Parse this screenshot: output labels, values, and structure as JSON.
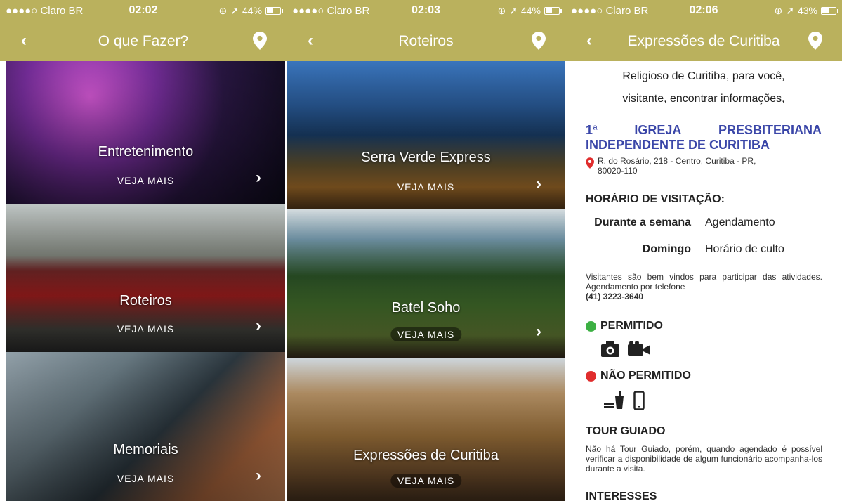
{
  "screens": [
    {
      "status": {
        "carrier": "●●●●○ Claro BR",
        "time": "02:02",
        "battery": "44%",
        "battery_level": 0.44
      },
      "nav": {
        "back": "‹",
        "title": "O que Fazer?"
      },
      "cards": [
        {
          "title": "Entretenimento",
          "more": "VEJA MAIS"
        },
        {
          "title": "Roteiros",
          "more": "VEJA MAIS"
        },
        {
          "title": "Memoriais",
          "more": "VEJA MAIS"
        }
      ]
    },
    {
      "status": {
        "carrier": "●●●●○ Claro BR",
        "time": "02:03",
        "battery": "44%",
        "battery_level": 0.44
      },
      "nav": {
        "back": "‹",
        "title": "Roteiros"
      },
      "cards": [
        {
          "title": "Serra Verde Express",
          "more": "VEJA MAIS"
        },
        {
          "title": "Batel Soho",
          "more": "VEJA MAIS"
        },
        {
          "title": "Expressões de Curitiba",
          "more": "VEJA MAIS"
        }
      ]
    },
    {
      "status": {
        "carrier": "●●●●○ Claro BR",
        "time": "02:06",
        "battery": "43%",
        "battery_level": 0.43
      },
      "nav": {
        "back": "‹",
        "title": "Expressões de Curitiba"
      },
      "detail": {
        "intro_line1": "Religioso de Curitiba, para você,",
        "intro_line2": "visitante, encontrar informações,",
        "church_num": "1ª",
        "church_word1": "IGREJA",
        "church_word2": "PRESBITERIANA",
        "church_line2": "INDEPENDENTE DE CURITIBA",
        "address_line1": "R. do Rosário, 218 - Centro, Curitiba - PR,",
        "address_line2": "80020-110",
        "visit_heading": "HORÁRIO DE VISITAÇÃO:",
        "schedule": [
          {
            "day": "Durante a semana",
            "value": "Agendamento"
          },
          {
            "day": "Domingo",
            "value": "Horário de culto"
          }
        ],
        "visitors_text": "Visitantes são bem vindos para participar das atividades. Agendamento por telefone",
        "phone": "(41) 3223-3640",
        "allowed_label": "PERMITIDO",
        "allowed_color": "#3cb043",
        "not_allowed_label": "NÃO PERMITIDO",
        "not_allowed_color": "#e02d2d",
        "allowed_icons": [
          "camera-icon",
          "video-camera-icon"
        ],
        "not_allowed_icons": [
          "food-drink-icon",
          "phone-icon"
        ],
        "tour_heading": "TOUR GUIADO",
        "tour_text": "Não há Tour Guiado, porém, quando agendado é possível verificar a disponibilidade de algum funcionário acompanha-los durante a visita.",
        "interests_heading": "INTERESSES"
      }
    }
  ],
  "colors": {
    "header": "#bab15d",
    "church_title": "#3a46a8",
    "pin": "#e02d2d"
  }
}
